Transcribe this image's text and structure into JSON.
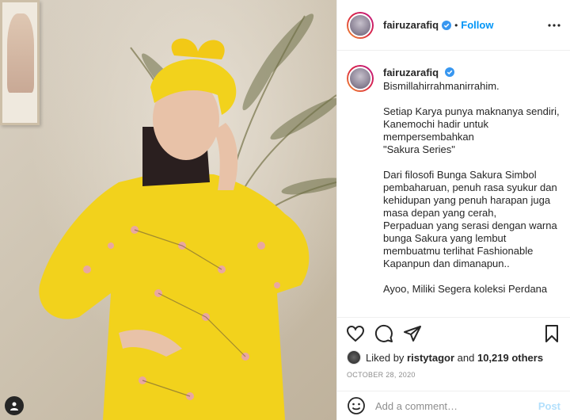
{
  "post": {
    "username": "fairuzarafiq",
    "follow_label": "Follow",
    "separator": "•",
    "caption_text": "Bismillahirrahmanirrahim.\n\nSetiap Karya punya maknanya sendiri,\nKanemochi hadir untuk mempersembahkan\n\"Sakura Series\"\n\nDari filosofi Bunga Sakura Simbol pembaharuan, penuh rasa syukur dan kehidupan yang penuh harapan juga masa depan yang cerah,\nPerpaduan yang serasi dengan warna bunga Sakura yang lembut membuatmu terlihat Fashionable Kapanpun dan dimanapun..\n\nAyoo, Miliki Segera koleksi Perdana",
    "likes": {
      "prefix": "Liked by",
      "user": "ristytagor",
      "conjunction": "and",
      "others": "10,219 others"
    },
    "date": "OCTOBER 28, 2020",
    "comment_placeholder": "Add a comment…",
    "post_label": "Post"
  },
  "colors": {
    "accent": "#0095f6",
    "verified": "#3897f0",
    "post_disabled": "#b2dffc",
    "dress": "#f2d21c"
  },
  "icons": [
    "verified-icon",
    "more-options-icon",
    "heart-icon",
    "comment-icon",
    "share-icon",
    "bookmark-icon",
    "emoji-icon",
    "profile-icon"
  ]
}
